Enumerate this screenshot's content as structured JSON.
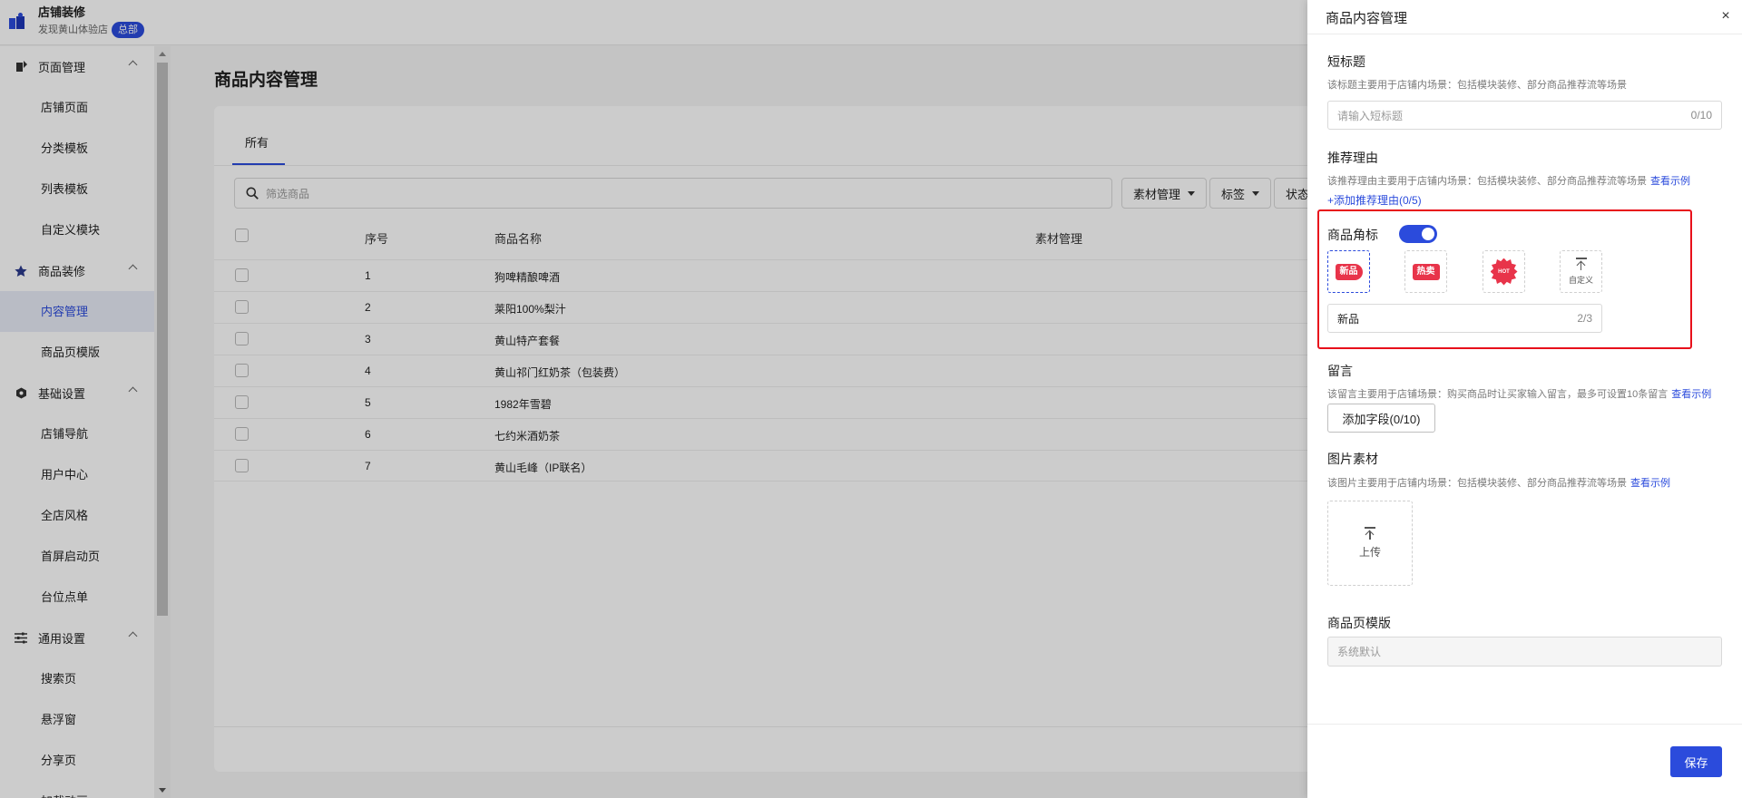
{
  "app": {
    "title": "店铺装修",
    "store_name": "发现黄山体验店",
    "hq_badge": "总部"
  },
  "sidebar": {
    "groups": [
      {
        "label": "页面管理",
        "items": [
          "店铺页面",
          "分类模板",
          "列表模板",
          "自定义模块"
        ]
      },
      {
        "label": "商品装修",
        "items": [
          "内容管理",
          "商品页模版"
        ]
      },
      {
        "label": "基础设置",
        "items": [
          "店铺导航",
          "用户中心",
          "全店风格",
          "首屏启动页",
          "台位点单"
        ]
      },
      {
        "label": "通用设置",
        "items": [
          "搜索页",
          "悬浮窗",
          "分享页",
          "加载动画"
        ]
      }
    ],
    "active_item": "内容管理"
  },
  "main": {
    "page_title": "商品内容管理",
    "tab_all": "所有",
    "search_placeholder": "筛选商品",
    "filters": [
      "素材管理",
      "标签",
      "状态"
    ],
    "columns": {
      "index": "序号",
      "name": "商品名称",
      "material": "素材管理"
    },
    "rows": [
      {
        "index": "1",
        "name": "狗啤精酿啤酒"
      },
      {
        "index": "2",
        "name": "莱阳100%梨汁"
      },
      {
        "index": "3",
        "name": "黄山特产套餐"
      },
      {
        "index": "4",
        "name": "黄山祁门红奶茶（包装费）"
      },
      {
        "index": "5",
        "name": "1982年雪碧"
      },
      {
        "index": "6",
        "name": "七约米酒奶茶"
      },
      {
        "index": "7",
        "name": "黄山毛峰（IP联名）"
      }
    ]
  },
  "drawer": {
    "title": "商品内容管理",
    "close": "×",
    "short_title": {
      "label": "短标题",
      "desc": "该标题主要用于店铺内场景：包括模块装修、部分商品推荐流等场景",
      "placeholder": "请输入短标题",
      "count": "0/10"
    },
    "reason": {
      "label": "推荐理由",
      "desc": "该推荐理由主要用于店铺内场景：包括模块装修、部分商品推荐流等场景",
      "link": "查看示例",
      "add": "+添加推荐理由(0/5)"
    },
    "corner": {
      "label": "商品角标",
      "toggle_on": true,
      "options": [
        "新品",
        "热卖",
        "HOT",
        "自定义"
      ],
      "selected": "新品",
      "value": "新品",
      "count": "2/3"
    },
    "message": {
      "label": "留言",
      "desc": "该留言主要用于店铺场景：购买商品时让买家输入留言，最多可设置10条留言",
      "link": "查看示例",
      "button": "添加字段(0/10)"
    },
    "image": {
      "label": "图片素材",
      "desc": "该图片主要用于店铺内场景：包括模块装修、部分商品推荐流等场景",
      "link": "查看示例",
      "upload": "上传"
    },
    "template": {
      "label": "商品页模版",
      "value": "系统默认"
    },
    "save": "保存"
  },
  "colors": {
    "accent": "#2b4bdc",
    "highlight": "#e8101b",
    "tag": "#e8344a"
  }
}
